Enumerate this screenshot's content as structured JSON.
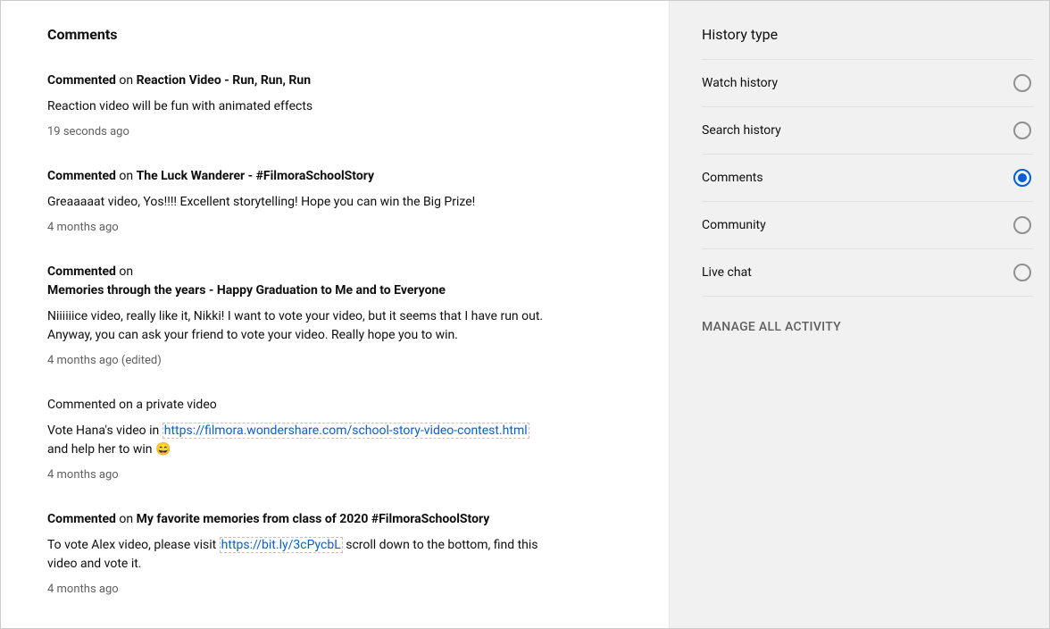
{
  "page": {
    "title": "Comments"
  },
  "labels": {
    "commented": "Commented",
    "on": "on",
    "private": "a private video"
  },
  "comments": [
    {
      "title": "Reaction Video - Run, Run, Run",
      "body_parts": [
        {
          "type": "text",
          "text": "Reaction video will be fun with animated effects"
        }
      ],
      "time": "19 seconds ago",
      "private": false
    },
    {
      "title": "The Luck Wanderer - #FilmoraSchoolStory",
      "body_parts": [
        {
          "type": "text",
          "text": "Greaaaaat video, Yos!!!! Excellent storytelling! Hope you can win the Big Prize!"
        }
      ],
      "time": "4 months ago",
      "private": false
    },
    {
      "title": "Memories through the years - Happy Graduation to Me and to Everyone",
      "body_parts": [
        {
          "type": "text",
          "text": "Niiiiiice video, really like it, Nikki! I want to vote your video, but it seems that I have run out. Anyway, you can ask your friend to vote your video. Really hope you to win."
        }
      ],
      "time": "4 months ago (edited)",
      "private": false,
      "title_on_new_line": true
    },
    {
      "title": "",
      "body_parts": [
        {
          "type": "text",
          "text": "Vote Hana's video in "
        },
        {
          "type": "link",
          "text": "https://filmora.wondershare.com/school-story-video-contest.html"
        },
        {
          "type": "text",
          "text": " and help her to win 😄"
        }
      ],
      "time": "4 months ago",
      "private": true
    },
    {
      "title": "My favorite memories from class of 2020 #FilmoraSchoolStory",
      "body_parts": [
        {
          "type": "text",
          "text": "To vote Alex video, please visit "
        },
        {
          "type": "link",
          "text": "https://bit.ly/3cPycbL"
        },
        {
          "type": "text",
          "text": " scroll down to the bottom, find this video and vote it."
        }
      ],
      "time": "4 months ago",
      "private": false
    }
  ],
  "sidebar": {
    "title": "History type",
    "options": [
      {
        "label": "Watch history",
        "selected": false
      },
      {
        "label": "Search history",
        "selected": false
      },
      {
        "label": "Comments",
        "selected": true
      },
      {
        "label": "Community",
        "selected": false
      },
      {
        "label": "Live chat",
        "selected": false
      }
    ],
    "manage": "MANAGE ALL ACTIVITY"
  }
}
